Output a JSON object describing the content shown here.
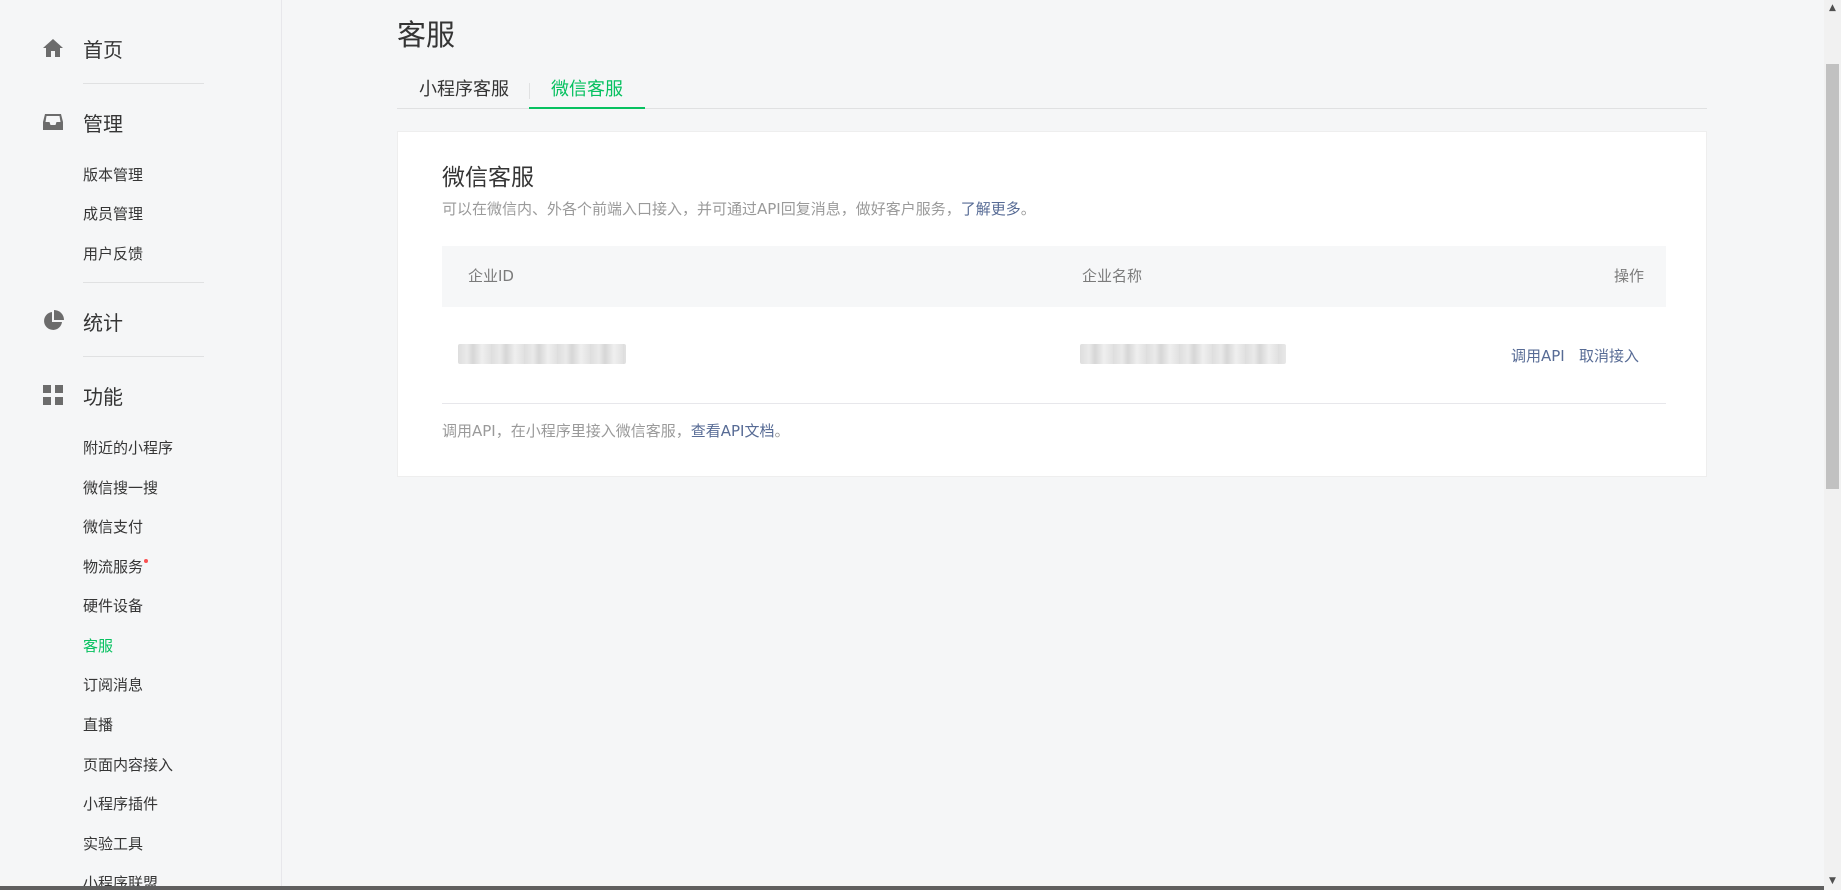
{
  "colors": {
    "accent": "#07c160",
    "link": "#576b95",
    "background": "#f5f6f7",
    "badge": "#fa5151"
  },
  "sidebar": {
    "home": {
      "icon": "home-icon",
      "label": "首页"
    },
    "manage": {
      "icon": "inbox-icon",
      "label": "管理",
      "items": [
        "版本管理",
        "成员管理",
        "用户反馈"
      ]
    },
    "stats": {
      "icon": "pie-chart-icon",
      "label": "统计"
    },
    "features": {
      "icon": "grid-icon",
      "label": "功能",
      "items": [
        "附近的小程序",
        "微信搜一搜",
        "微信支付",
        "物流服务",
        "硬件设备",
        "客服",
        "订阅消息",
        "直播",
        "页面内容接入",
        "小程序插件",
        "实验工具",
        "小程序联盟"
      ],
      "active_item": "客服",
      "badge_item": "物流服务"
    }
  },
  "main": {
    "title": "客服",
    "tabs": [
      {
        "label": "小程序客服",
        "active": false
      },
      {
        "label": "微信客服",
        "active": true
      }
    ],
    "card": {
      "title": "微信客服",
      "desc": "可以在微信内、外各个前端入口接入，并可通过API回复消息，做好客户服务，",
      "desc_link": "了解更多",
      "desc_end": "。",
      "table": {
        "headers": {
          "id": "企业ID",
          "name": "企业名称",
          "ops": "操作"
        },
        "rows": [
          {
            "actions": {
              "call_api": "调用API",
              "cancel": "取消接入"
            }
          }
        ]
      },
      "foot": "调用API，在小程序里接入微信客服，",
      "foot_link": "查看API文档",
      "foot_end": "。"
    }
  }
}
